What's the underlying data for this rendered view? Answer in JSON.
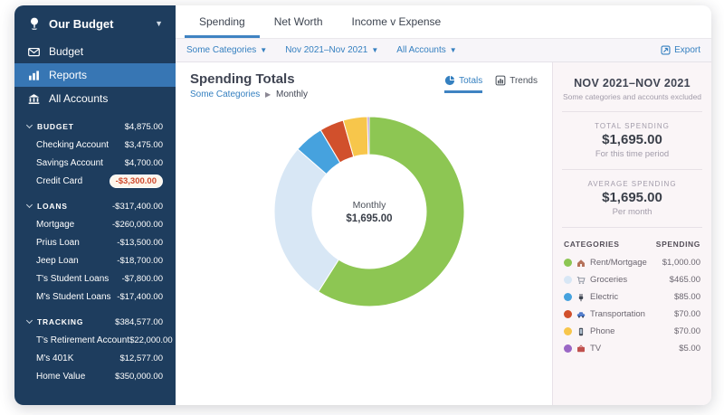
{
  "sidebar": {
    "budget_name": "Our Budget",
    "nav": [
      {
        "label": "Budget",
        "icon": "envelope-icon"
      },
      {
        "label": "Reports",
        "icon": "bar-chart-icon",
        "active": true
      },
      {
        "label": "All Accounts",
        "icon": "bank-icon"
      }
    ],
    "sections": [
      {
        "label": "BUDGET",
        "total": "$4,875.00",
        "accounts": [
          {
            "name": "Checking Account",
            "balance": "$3,475.00"
          },
          {
            "name": "Savings Account",
            "balance": "$4,700.00"
          },
          {
            "name": "Credit Card",
            "balance": "-$3,300.00",
            "pill": true
          }
        ]
      },
      {
        "label": "LOANS",
        "total": "-$317,400.00",
        "accounts": [
          {
            "name": "Mortgage",
            "balance": "-$260,000.00"
          },
          {
            "name": "Prius Loan",
            "balance": "-$13,500.00"
          },
          {
            "name": "Jeep Loan",
            "balance": "-$18,700.00"
          },
          {
            "name": "T's Student Loans",
            "balance": "-$7,800.00"
          },
          {
            "name": "M's Student Loans",
            "balance": "-$17,400.00"
          }
        ]
      },
      {
        "label": "TRACKING",
        "total": "$384,577.00",
        "accounts": [
          {
            "name": "T's Retirement Account",
            "balance": "$22,000.00"
          },
          {
            "name": "M's 401K",
            "balance": "$12,577.00"
          },
          {
            "name": "Home Value",
            "balance": "$350,000.00"
          }
        ]
      }
    ]
  },
  "tabs": [
    {
      "label": "Spending",
      "active": true
    },
    {
      "label": "Net Worth"
    },
    {
      "label": "Income v Expense"
    }
  ],
  "filters": {
    "categories": "Some Categories",
    "date_range": "Nov 2021–Nov 2021",
    "accounts": "All Accounts",
    "export_label": "Export"
  },
  "report": {
    "title": "Spending Totals",
    "breadcrumb_link": "Some Categories",
    "breadcrumb_current": "Monthly",
    "view_toggle": [
      {
        "label": "Totals",
        "active": true
      },
      {
        "label": "Trends"
      }
    ]
  },
  "summary": {
    "date_range_title": "NOV 2021–NOV 2021",
    "subtitle": "Some categories and accounts excluded",
    "total_spending": {
      "label": "TOTAL SPENDING",
      "value": "$1,695.00",
      "sub": "For this time period"
    },
    "average_spending": {
      "label": "AVERAGE SPENDING",
      "value": "$1,695.00",
      "sub": "Per month"
    },
    "table": {
      "col_categories": "CATEGORIES",
      "col_spending": "SPENDING",
      "rows": [
        {
          "name": "Rent/Mortgage",
          "amount": "$1,000.00",
          "color": "#8dc653",
          "icon": "house-icon"
        },
        {
          "name": "Groceries",
          "amount": "$465.00",
          "color": "#d8e7f5",
          "icon": "cart-icon"
        },
        {
          "name": "Electric",
          "amount": "$85.00",
          "color": "#46a2de",
          "icon": "plug-icon"
        },
        {
          "name": "Transportation",
          "amount": "$70.00",
          "color": "#d1502c",
          "icon": "car-icon"
        },
        {
          "name": "Phone",
          "amount": "$70.00",
          "color": "#f7c64b",
          "icon": "phone-icon"
        },
        {
          "name": "TV",
          "amount": "$5.00",
          "color": "#9a67c5",
          "icon": "tv-icon"
        }
      ]
    }
  },
  "chart_data": {
    "type": "pie",
    "donut": true,
    "title": "Spending Totals",
    "center_label": "Monthly",
    "center_value": "$1,695.00",
    "categories": [
      "Rent/Mortgage",
      "Groceries",
      "Electric",
      "Transportation",
      "Phone",
      "TV"
    ],
    "values": [
      1000,
      465,
      85,
      70,
      70,
      5
    ],
    "total": 1695,
    "colors": [
      "#8dc653",
      "#d8e7f5",
      "#46a2de",
      "#d1502c",
      "#f7c64b",
      "#9a67c5"
    ],
    "legend_position": "right"
  }
}
